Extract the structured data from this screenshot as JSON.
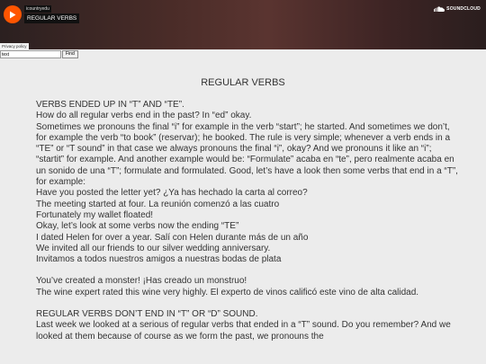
{
  "player": {
    "uploader": "icountryedu",
    "track_title": "REGULAR VERBS",
    "brand": "SOUNDCLOUD",
    "privacy_label": "Privacy policy",
    "brand_color": "#ff5500",
    "play_icon": "play-icon",
    "logo_icon": "soundcloud-cloud-icon"
  },
  "search": {
    "value": "text",
    "button_label": "Find"
  },
  "page": {
    "title": "REGULAR VERBS",
    "lines_a": [
      "VERBS ENDED UP IN “T” AND “TE”.",
      "How do all regular verbs end in the past? In “ed” okay.",
      "Sometimes we pronouns the final “i” for example in the verb “start”; he started. And sometimes we don’t, for example the verb “to book” (reservar); he booked. The rule is very simple; whenever a verb ends in a “TE” or “T sound” in that case we always pronouns the final “i”, okay? And we pronouns it like an “i”; “startit” for example. And another example would be: “Formulate” acaba en “te”, pero realmente acaba en un sonido de una “T”; formulate and formulated. Good, let’s have a look then some verbs that end in a “T”, for example:",
      "Have you posted the letter yet? ¿Ya has hechado la carta al correo?",
      "The meeting started at four. La reunión comenzó a las cuatro",
      "Fortunately my wallet floated!",
      "Okay, let’s look at some verbs now the ending “TE”",
      "I dated Helen for over a year. Salí con Helen durante más de un año",
      "We invited all our friends to our silver wedding anniversary.",
      "Invitamos a todos nuestros amigos a nuestras bodas de plata"
    ],
    "lines_b": [
      "You’ve created a monster! ¡Has creado un monstruo!",
      "The wine expert rated this wine very highly. El experto de vinos calificó este vino de alta calidad."
    ],
    "lines_c": [
      "REGULAR VERBS DON’T END IN “T” OR “D” SOUND.",
      "Last week we looked at a serious of regular verbs that ended in a “T” sound. Do you remember? And we looked at them because of course as we form the past, we pronouns the"
    ]
  }
}
